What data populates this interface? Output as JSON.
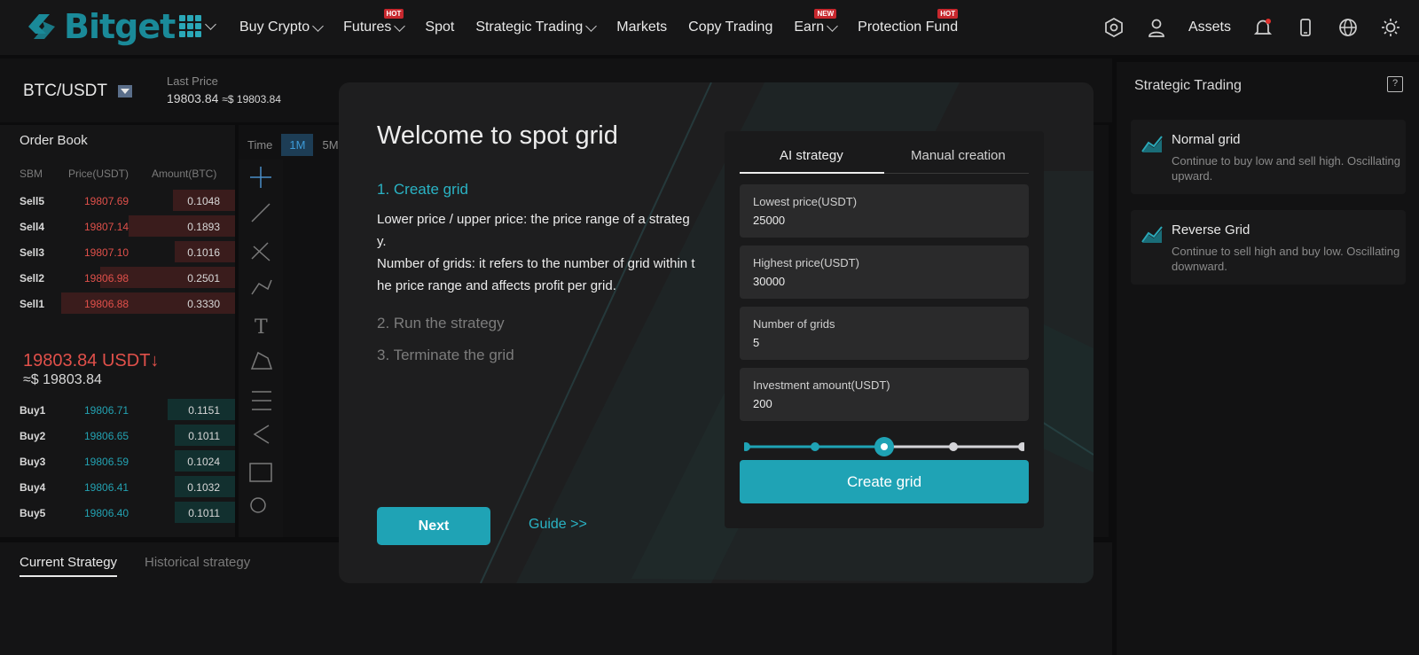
{
  "brand": {
    "name": "Bitget"
  },
  "nav": {
    "items": [
      {
        "label": "Buy Crypto",
        "dropdown": true,
        "badge": ""
      },
      {
        "label": "Futures",
        "dropdown": true,
        "badge": "HOT"
      },
      {
        "label": "Spot",
        "dropdown": false,
        "badge": ""
      },
      {
        "label": "Strategic Trading",
        "dropdown": true,
        "badge": ""
      },
      {
        "label": "Markets",
        "dropdown": false,
        "badge": ""
      },
      {
        "label": "Copy Trading",
        "dropdown": false,
        "badge": ""
      },
      {
        "label": "Earn",
        "dropdown": true,
        "badge": "NEW"
      },
      {
        "label": "Protection Fund",
        "dropdown": false,
        "badge": "HOT"
      }
    ],
    "assets_label": "Assets"
  },
  "ticker": {
    "pair": "BTC/USDT",
    "last_price_label": "Last Price",
    "last_price": "19803.84",
    "last_price_usd": "≈$ 19803.84"
  },
  "order_book": {
    "title": "Order Book",
    "headers": [
      "SBM",
      "Price(USDT)",
      "Amount(BTC)"
    ],
    "sells": [
      {
        "label": "Sell5",
        "price": "19807.69",
        "amount": "0.1048",
        "depth": 0.35
      },
      {
        "label": "Sell4",
        "price": "19807.14",
        "amount": "0.1893",
        "depth": 0.6
      },
      {
        "label": "Sell3",
        "price": "19807.10",
        "amount": "0.1016",
        "depth": 0.34
      },
      {
        "label": "Sell2",
        "price": "19806.98",
        "amount": "0.2501",
        "depth": 0.76
      },
      {
        "label": "Sell1",
        "price": "19806.88",
        "amount": "0.3330",
        "depth": 0.98
      }
    ],
    "mid_price": "19803.84 USDT↓",
    "mid_usd": "≈$ 19803.84",
    "buys": [
      {
        "label": "Buy1",
        "price": "19806.71",
        "amount": "0.1151",
        "depth": 0.38
      },
      {
        "label": "Buy2",
        "price": "19806.65",
        "amount": "0.1011",
        "depth": 0.34
      },
      {
        "label": "Buy3",
        "price": "19806.59",
        "amount": "0.1024",
        "depth": 0.34
      },
      {
        "label": "Buy4",
        "price": "19806.41",
        "amount": "0.1032",
        "depth": 0.34
      },
      {
        "label": "Buy5",
        "price": "19806.40",
        "amount": "0.1011",
        "depth": 0.34
      }
    ]
  },
  "chart": {
    "time_label": "Time",
    "active_interval": "1M",
    "next_interval": "5M"
  },
  "bottom_tabs": {
    "current": "Current Strategy",
    "historical": "Historical strategy"
  },
  "right_panel": {
    "title": "Strategic Trading",
    "help": "?",
    "cards": [
      {
        "title": "Normal grid",
        "desc": "Continue to buy low and sell high. Oscillating upward."
      },
      {
        "title": "Reverse Grid",
        "desc": "Continue to sell high and buy low. Oscillating downward."
      }
    ]
  },
  "modal": {
    "title": "Welcome to spot grid",
    "step1": "1. Create grid",
    "step1_desc1": "Lower price / upper price: the price range of a strategy.",
    "step1_desc2": "Number of grids: it refers to the number of grid within the price range and affects profit per grid.",
    "step2": "2. Run the strategy",
    "step3": "3. Terminate the grid",
    "next": "Next",
    "guide": "Guide >>",
    "form": {
      "tab_ai": "AI strategy",
      "tab_manual": "Manual creation",
      "lowest_label": "Lowest price(USDT)",
      "lowest_value": "25000",
      "highest_label": "Highest price(USDT)",
      "highest_value": "30000",
      "grids_label": "Number of grids",
      "grids_value": "5",
      "invest_label": "Investment amount(USDT)",
      "invest_value": "200",
      "slider_level": 0.5,
      "create": "Create grid"
    }
  },
  "colors": {
    "accent": "#1fa3b5",
    "sell": "#e0504a",
    "buy": "#23a2b2"
  }
}
